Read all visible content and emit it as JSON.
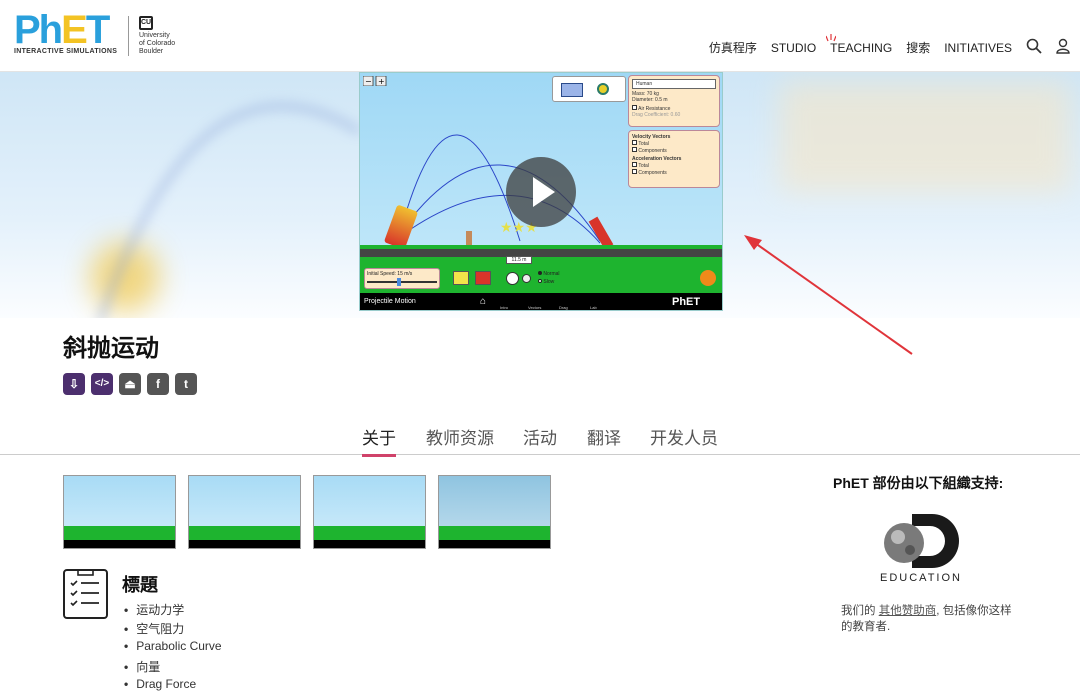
{
  "header": {
    "logo_ph": "Ph",
    "logo_e": "E",
    "logo_t": "T",
    "logo_subtitle": "INTERACTIVE SIMULATIONS",
    "cu_line1": "University",
    "cu_line2": "of Colorado",
    "cu_line3": "Boulder",
    "nav": [
      "仿真程序",
      "STUDIO",
      "TEACHING",
      "搜索",
      "INITIATIVES"
    ]
  },
  "sim": {
    "title": "Projectile Motion",
    "object_select": "Human",
    "mass": "Mass: 70 kg",
    "diameter": "Diameter: 0.5 m",
    "air_resistance": "Air Resistance",
    "drag": "Drag Coefficient: 0.60",
    "velocity_vectors": "Velocity Vectors",
    "total": "Total",
    "components": "Components",
    "acceleration_vectors": "Acceleration Vectors",
    "initial_speed": "Initial Speed: 15 m/s",
    "distance": "11.5 m",
    "normal": "Normal",
    "slow": "Slow",
    "screens": [
      "Intro",
      "Vectors",
      "Drag",
      "Lab"
    ],
    "brand": "PhET"
  },
  "page": {
    "title": "斜抛运动"
  },
  "tabs": [
    "关于",
    "教师资源",
    "活动",
    "翻译",
    "开发人员"
  ],
  "topics": {
    "title": "標題",
    "items": [
      "运动力学",
      "空气阻力",
      "Parabolic Curve",
      "向量",
      "Drag Force"
    ]
  },
  "sponsor": {
    "title": "PhET 部份由以下組織支持:",
    "logo_text": "EDUCATION",
    "note_before": "我们的",
    "note_link": "其他赞助商",
    "note_after": ", 包括像你这样的教育者."
  },
  "colors": {
    "brand_blue": "#2aa0dc",
    "brand_yellow": "#f3c324",
    "share_purple": "#4c2f6e",
    "share_gray": "#555555",
    "tab_active": "#d0426a",
    "arrow_red": "#e0343a"
  }
}
